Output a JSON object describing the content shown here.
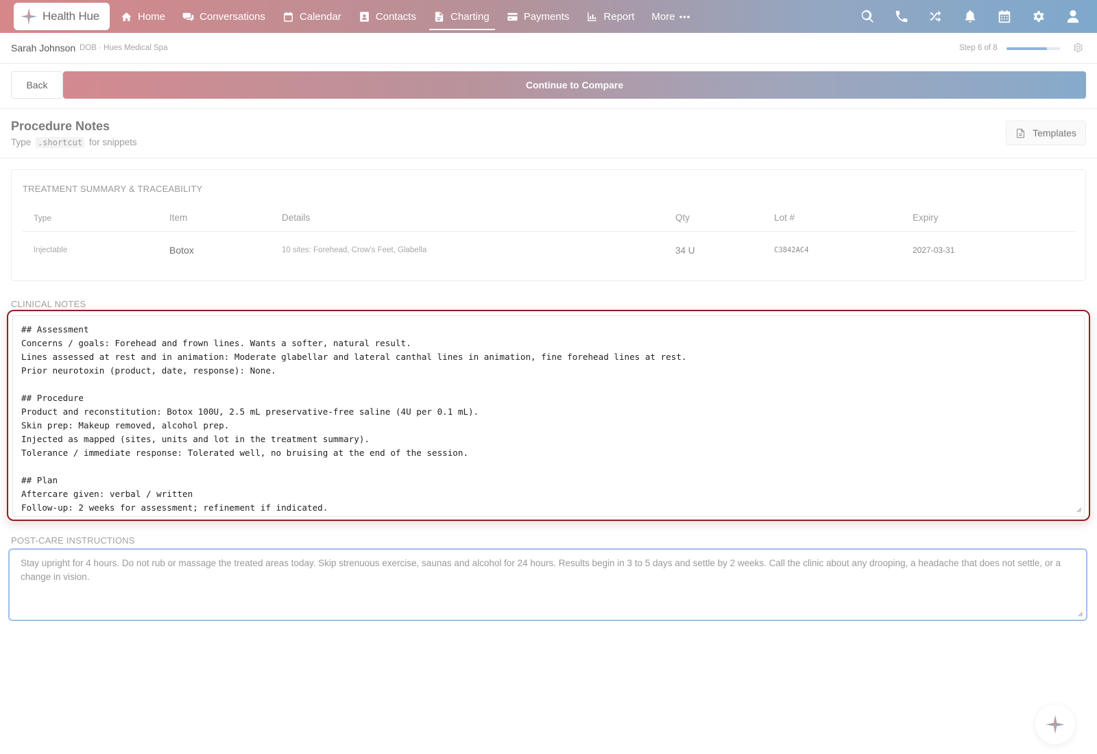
{
  "app": {
    "name": "Health Hue",
    "logo_icon": "health-hue-logo-icon"
  },
  "nav": {
    "items": [
      {
        "label": "Home",
        "icon": "home-icon"
      },
      {
        "label": "Conversations",
        "icon": "chat-icon"
      },
      {
        "label": "Calendar",
        "icon": "calendar-icon"
      },
      {
        "label": "Contacts",
        "icon": "contact-card-icon"
      },
      {
        "label": "Charting",
        "icon": "document-icon",
        "active": true
      },
      {
        "label": "Payments",
        "icon": "credit-card-icon"
      },
      {
        "label": "Report",
        "icon": "bar-chart-icon"
      },
      {
        "label": "More",
        "icon": "ellipsis-icon"
      }
    ],
    "more_dots": "•••",
    "right_icons": [
      "search-icon",
      "phone-icon",
      "shuffle-icon",
      "bell-icon",
      "calendar-grid-icon",
      "gear-icon",
      "user-icon"
    ]
  },
  "patient": {
    "name": "Sarah Johnson",
    "meta": "DOB · Hues Medical Spa",
    "step_text": "Step 6 of 8",
    "progress": 0.75
  },
  "actions": {
    "back_label": "Back",
    "continue_label": "Continue to Compare"
  },
  "section": {
    "title": "Procedure Notes",
    "sub_prefix": "Type",
    "sub_code": ".shortcut",
    "sub_suffix": "for snippets",
    "templates_label": "Templates"
  },
  "summary": {
    "title": "TREATMENT SUMMARY & TRACEABILITY",
    "columns": [
      "Type",
      "Item",
      "Details",
      "Qty",
      "Lot #",
      "Expiry"
    ],
    "rows": [
      {
        "type": "Injectable",
        "item": "Botox",
        "details": "10 sites: Forehead, Crow's Feet, Glabella",
        "qty": "34 U",
        "lot": "C3842AC4",
        "expiry": "2027-03-31"
      }
    ]
  },
  "clinical": {
    "label": "CLINICAL NOTES",
    "text": "## Assessment\nConcerns / goals: Forehead and frown lines. Wants a softer, natural result.\nLines assessed at rest and in animation: Moderate glabellar and lateral canthal lines in animation, fine forehead lines at rest.\nPrior neurotoxin (product, date, response): None.\n\n## Procedure\nProduct and reconstitution: Botox 100U, 2.5 mL preservative-free saline (4U per 0.1 mL).\nSkin prep: Makeup removed, alcohol prep.\nInjected as mapped (sites, units and lot in the treatment summary).\nTolerance / immediate response: Tolerated well, no bruising at the end of the session.\n\n## Plan\nAftercare given: verbal / written\nFollow-up: 2 weeks for assessment; refinement if indicated."
  },
  "postcare": {
    "label": "POST-CARE INSTRUCTIONS",
    "text": "Stay upright for 4 hours. Do not rub or massage the treated areas today. Skip strenuous exercise, saunas and alcohol for 24 hours. Results begin in 3 to 5 days and settle by 2 weeks. Call the clinic about any drooping, a headache that does not settle, or a change in vision."
  },
  "colors": {
    "nav_gradient_start": "#d6878a",
    "nav_gradient_end": "#7ea8cc",
    "focus_red": "#8e1f24",
    "focus_blue": "#9ec2ea"
  },
  "fab_icon": "assistant-sparkle-icon"
}
